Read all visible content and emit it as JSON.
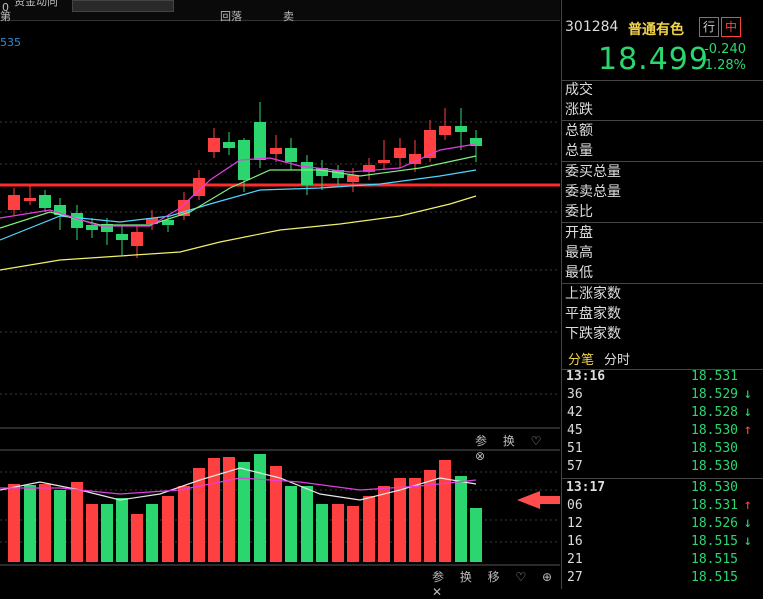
{
  "topbar": {
    "frag1": "0",
    "frag2": "资金动向",
    "frag3": "第",
    "frag4": "回落",
    "frag5": "卖"
  },
  "stock": {
    "code": "301284",
    "name": "普通有色",
    "btn_hang": "行",
    "btn_zhong": "中",
    "price": "18.499",
    "change": "-0.240",
    "change_pct": "-1.28%"
  },
  "chart": {
    "code_label": "535",
    "vol_icons": "参 换 ♡ ⊗",
    "ind_icons": "参 换 移 ♡ ⊕ ✕"
  },
  "stats": {
    "g1": [
      "成交",
      "涨跌"
    ],
    "g2": [
      "总额",
      "总量"
    ],
    "g3": [
      "委买总量",
      "委卖总量",
      "委比"
    ],
    "g4": [
      "开盘",
      "最高",
      "最低"
    ],
    "g5": [
      "上涨家数",
      "平盘家数",
      "下跌家数"
    ]
  },
  "tick_tabs": {
    "tab1": "分笔",
    "tab2": "分时"
  },
  "ticks": [
    {
      "t": "13:16",
      "p": "18.531",
      "a": ""
    },
    {
      "t": "36",
      "p": "18.529",
      "a": "down"
    },
    {
      "t": "42",
      "p": "18.528",
      "a": "down"
    },
    {
      "t": "45",
      "p": "18.530",
      "a": "up"
    },
    {
      "t": "51",
      "p": "18.530",
      "a": ""
    },
    {
      "t": "57",
      "p": "18.530",
      "a": ""
    },
    {
      "t": "13:17",
      "p": "18.530",
      "a": ""
    },
    {
      "t": "06",
      "p": "18.531",
      "a": "up"
    },
    {
      "t": "12",
      "p": "18.526",
      "a": "down"
    },
    {
      "t": "16",
      "p": "18.515",
      "a": "down"
    },
    {
      "t": "21",
      "p": "18.515",
      "a": ""
    },
    {
      "t": "27",
      "p": "18.515",
      "a": ""
    }
  ],
  "colors": {
    "up": "#ff4040",
    "down": "#2bd66f",
    "ma5": "#e6e6e6",
    "ma10": "#e23ee2",
    "ma20": "#7ef07e",
    "ma30": "#4fd6ff",
    "ma60": "#f0f06a"
  }
}
